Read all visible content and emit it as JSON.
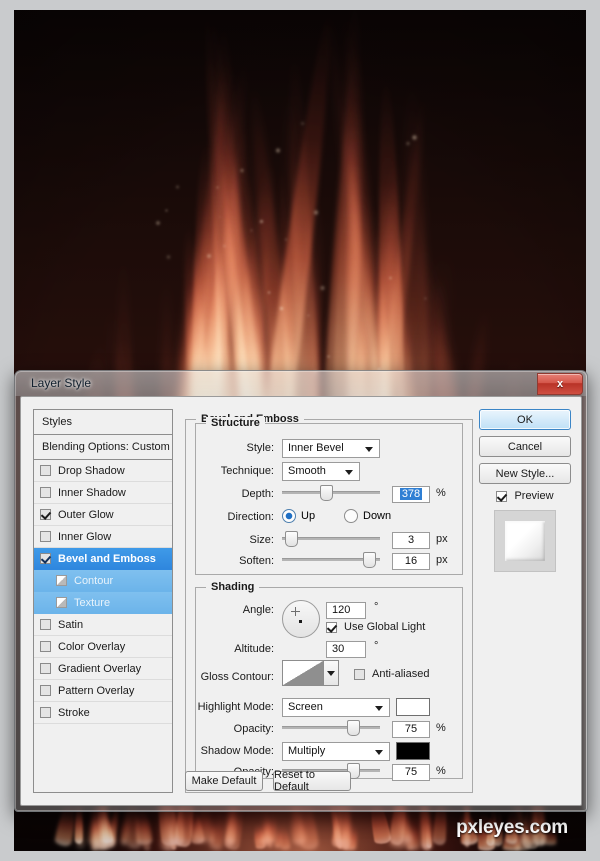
{
  "photo": {
    "watermark": "pxleyes.com",
    "description": "dark background with red-orange flames surrounding a silhouette"
  },
  "dialog": {
    "title": "Layer Style",
    "close_label": "x"
  },
  "styles_panel": {
    "header": "Styles",
    "blending_options": "Blending Options: Custom",
    "items": [
      {
        "label": "Drop Shadow",
        "checked": false,
        "selected": false,
        "sub": false
      },
      {
        "label": "Inner Shadow",
        "checked": false,
        "selected": false,
        "sub": false
      },
      {
        "label": "Outer Glow",
        "checked": true,
        "selected": false,
        "sub": false
      },
      {
        "label": "Inner Glow",
        "checked": false,
        "selected": false,
        "sub": false
      },
      {
        "label": "Bevel and Emboss",
        "checked": true,
        "selected": true,
        "sub": false
      },
      {
        "label": "Contour",
        "checked": false,
        "selected": false,
        "sub": true
      },
      {
        "label": "Texture",
        "checked": false,
        "selected": false,
        "sub": true
      },
      {
        "label": "Satin",
        "checked": false,
        "selected": false,
        "sub": false
      },
      {
        "label": "Color Overlay",
        "checked": false,
        "selected": false,
        "sub": false
      },
      {
        "label": "Gradient Overlay",
        "checked": false,
        "selected": false,
        "sub": false
      },
      {
        "label": "Pattern Overlay",
        "checked": false,
        "selected": false,
        "sub": false
      },
      {
        "label": "Stroke",
        "checked": false,
        "selected": false,
        "sub": false
      }
    ]
  },
  "main": {
    "group_title": "Bevel and Emboss",
    "structure": {
      "title": "Structure",
      "style_label": "Style:",
      "style_value": "Inner Bevel",
      "technique_label": "Technique:",
      "technique_value": "Smooth",
      "depth_label": "Depth:",
      "depth_value": "378",
      "depth_unit": "%",
      "depth_slider_pct": 44,
      "direction_label": "Direction:",
      "direction_up": "Up",
      "direction_down": "Down",
      "direction_selected": "Up",
      "size_label": "Size:",
      "size_value": "3",
      "size_unit": "px",
      "size_slider_pct": 3,
      "soften_label": "Soften:",
      "soften_value": "16",
      "soften_unit": "px",
      "soften_slider_pct": 93
    },
    "shading": {
      "title": "Shading",
      "angle_label": "Angle:",
      "angle_value": "120",
      "angle_unit": "°",
      "use_global_light_label": "Use Global Light",
      "use_global_light_checked": true,
      "altitude_label": "Altitude:",
      "altitude_value": "30",
      "altitude_unit": "°",
      "gloss_contour_label": "Gloss Contour:",
      "anti_aliased_label": "Anti-aliased",
      "anti_aliased_checked": false,
      "highlight_mode_label": "Highlight Mode:",
      "highlight_mode_value": "Screen",
      "highlight_color": "#ffffff",
      "highlight_opacity_label": "Opacity:",
      "highlight_opacity_value": "75",
      "highlight_opacity_unit": "%",
      "highlight_opacity_pct": 75,
      "shadow_mode_label": "Shadow Mode:",
      "shadow_mode_value": "Multiply",
      "shadow_color": "#000000",
      "shadow_opacity_label": "Opacity:",
      "shadow_opacity_value": "75",
      "shadow_opacity_unit": "%",
      "shadow_opacity_pct": 75
    }
  },
  "buttons": {
    "ok": "OK",
    "cancel": "Cancel",
    "new_style": "New Style...",
    "preview": "Preview",
    "preview_checked": true,
    "make_default": "Make Default",
    "reset_to_default": "Reset to Default"
  },
  "colors": {
    "selection_blue": "#2f87de",
    "sub_selection_blue": "#6cb4ea",
    "close_red": "#c0392b",
    "dialog_bg": "#f0f0f0"
  }
}
